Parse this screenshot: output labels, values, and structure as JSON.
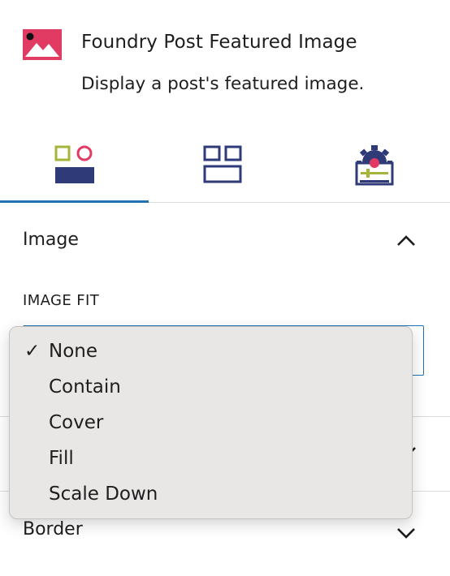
{
  "block": {
    "icon": "image-icon",
    "title": "Foundry Post Featured Image",
    "description": "Display a post's featured image."
  },
  "tabs": [
    {
      "icon": "general-settings-icon",
      "active": true
    },
    {
      "icon": "layout-icon",
      "active": false
    },
    {
      "icon": "advanced-settings-icon",
      "active": false
    }
  ],
  "image_panel": {
    "title": "Image",
    "fit_label": "IMAGE FIT",
    "selected": "None",
    "options": [
      "None",
      "Contain",
      "Cover",
      "Fill",
      "Scale Down"
    ],
    "check_mark": "✓"
  },
  "border_panel": {
    "title": "Border"
  },
  "colors": {
    "accent": "#2271b1",
    "icon_pink": "#e13a63",
    "icon_navy": "#2f3a78",
    "icon_olive": "#a6b43a"
  }
}
